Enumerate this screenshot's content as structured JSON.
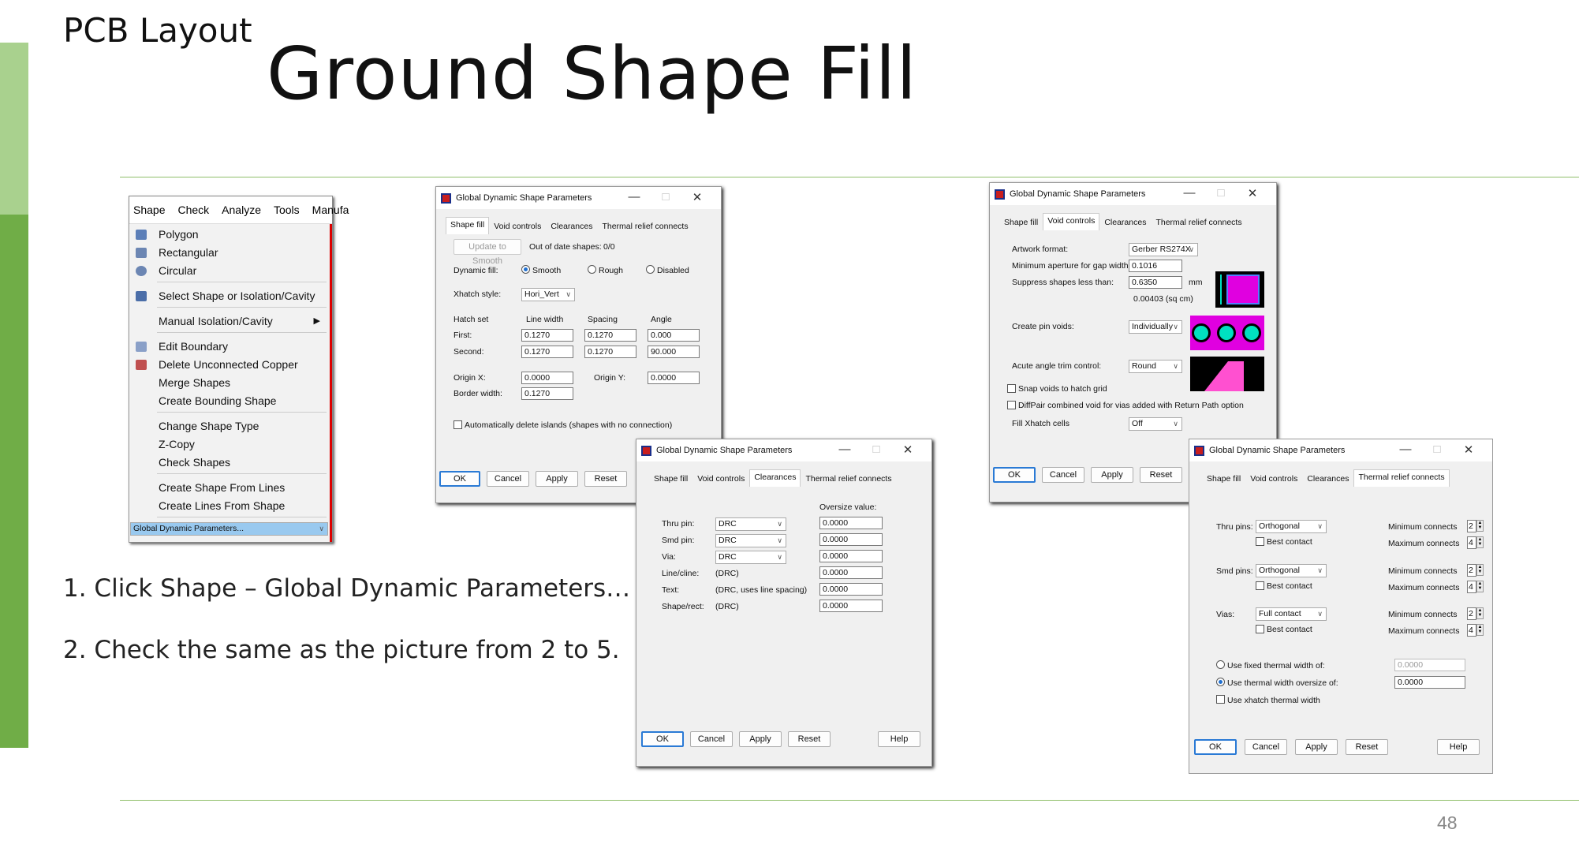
{
  "slide": {
    "section": "PCB Layout",
    "title": "Ground Shape Fill",
    "page_number": "48",
    "steps": [
      "1. Click Shape – Global Dynamic Parameters…",
      "2. Check the same as the picture from 2 to 5."
    ]
  },
  "menu": {
    "bar": [
      "Shape",
      "Check",
      "Analyze",
      "Tools",
      "Manufa"
    ],
    "items": [
      "Polygon",
      "Rectangular",
      "Circular",
      "Select Shape or Isolation/Cavity",
      "Manual Isolation/Cavity",
      "Edit Boundary",
      "Delete Unconnected Copper",
      "Merge Shapes",
      "Create Bounding Shape",
      "Change Shape Type",
      "Z-Copy",
      "Check Shapes",
      "Create Shape From Lines",
      "Create Lines From Shape",
      "Global Dynamic Parameters..."
    ]
  },
  "dialog_title": "Global Dynamic Shape Parameters",
  "tabs": [
    "Shape fill",
    "Void controls",
    "Clearances",
    "Thermal relief connects"
  ],
  "buttons": {
    "ok": "OK",
    "cancel": "Cancel",
    "apply": "Apply",
    "reset": "Reset",
    "help": "Help"
  },
  "shape_fill": {
    "update_btn": "Update to Smooth",
    "out_of_date_label": "Out of date shapes:",
    "out_of_date_value": "0/0",
    "dynamic_fill_label": "Dynamic fill:",
    "smooth": "Smooth",
    "rough": "Rough",
    "disabled": "Disabled",
    "xhatch_label": "Xhatch style:",
    "xhatch_value": "Hori_Vert",
    "hatch_set": "Hatch set",
    "line_width": "Line width",
    "spacing": "Spacing",
    "angle": "Angle",
    "first": "First:",
    "second": "Second:",
    "first_lw": "0.1270",
    "first_sp": "0.1270",
    "first_ang": "0.000",
    "second_lw": "0.1270",
    "second_sp": "0.1270",
    "second_ang": "90.000",
    "origin_x_label": "Origin X:",
    "origin_x": "0.0000",
    "origin_y_label": "Origin Y:",
    "origin_y": "0.0000",
    "border_label": "Border width:",
    "border": "0.1270",
    "auto_delete": "Automatically delete islands (shapes with no connection)"
  },
  "void": {
    "artwork_label": "Artwork format:",
    "artwork": "Gerber RS274X",
    "min_ap_label": "Minimum aperture for gap width:",
    "min_ap": "0.1016",
    "suppress_label": "Suppress shapes less than:",
    "suppress": "0.6350",
    "unit": "mm",
    "area": "0.00403 (sq cm)",
    "pin_voids_label": "Create pin voids:",
    "pin_voids": "Individually",
    "acute_label": "Acute angle trim control:",
    "acute": "Round",
    "snap": "Snap voids to hatch grid",
    "diffpair": "DiffPair combined void for vias added with Return Path option",
    "fill_label": "Fill Xhatch cells",
    "fill": "Off"
  },
  "clear": {
    "oversize": "Oversize value:",
    "rows": [
      [
        "Thru pin:",
        "DRC",
        "0.0000"
      ],
      [
        "Smd pin:",
        "DRC",
        "0.0000"
      ],
      [
        "Via:",
        "DRC",
        "0.0000"
      ],
      [
        "Line/cline:",
        "(DRC)",
        "0.0000"
      ],
      [
        "Text:",
        "(DRC, uses line spacing)",
        "0.0000"
      ],
      [
        "Shape/rect:",
        "(DRC)",
        "0.0000"
      ]
    ]
  },
  "thermal": {
    "thru": "Thru pins:",
    "smd": "Smd pins:",
    "vias": "Vias:",
    "ortho": "Orthogonal",
    "full": "Full contact",
    "best": "Best contact",
    "min": "Minimum connects",
    "max": "Maximum connects",
    "min_v": "2",
    "max_v": "4",
    "fixed": "Use fixed thermal width of:",
    "fixed_v": "0.0000",
    "oversize": "Use thermal width oversize of:",
    "oversize_v": "0.0000",
    "xhatch": "Use xhatch thermal width"
  },
  "colors": {
    "accent_light": "#a9d18e",
    "accent": "#70ad47",
    "thumb_magenta": "#e000e0",
    "thumb_cyan": "#00e0c0"
  }
}
